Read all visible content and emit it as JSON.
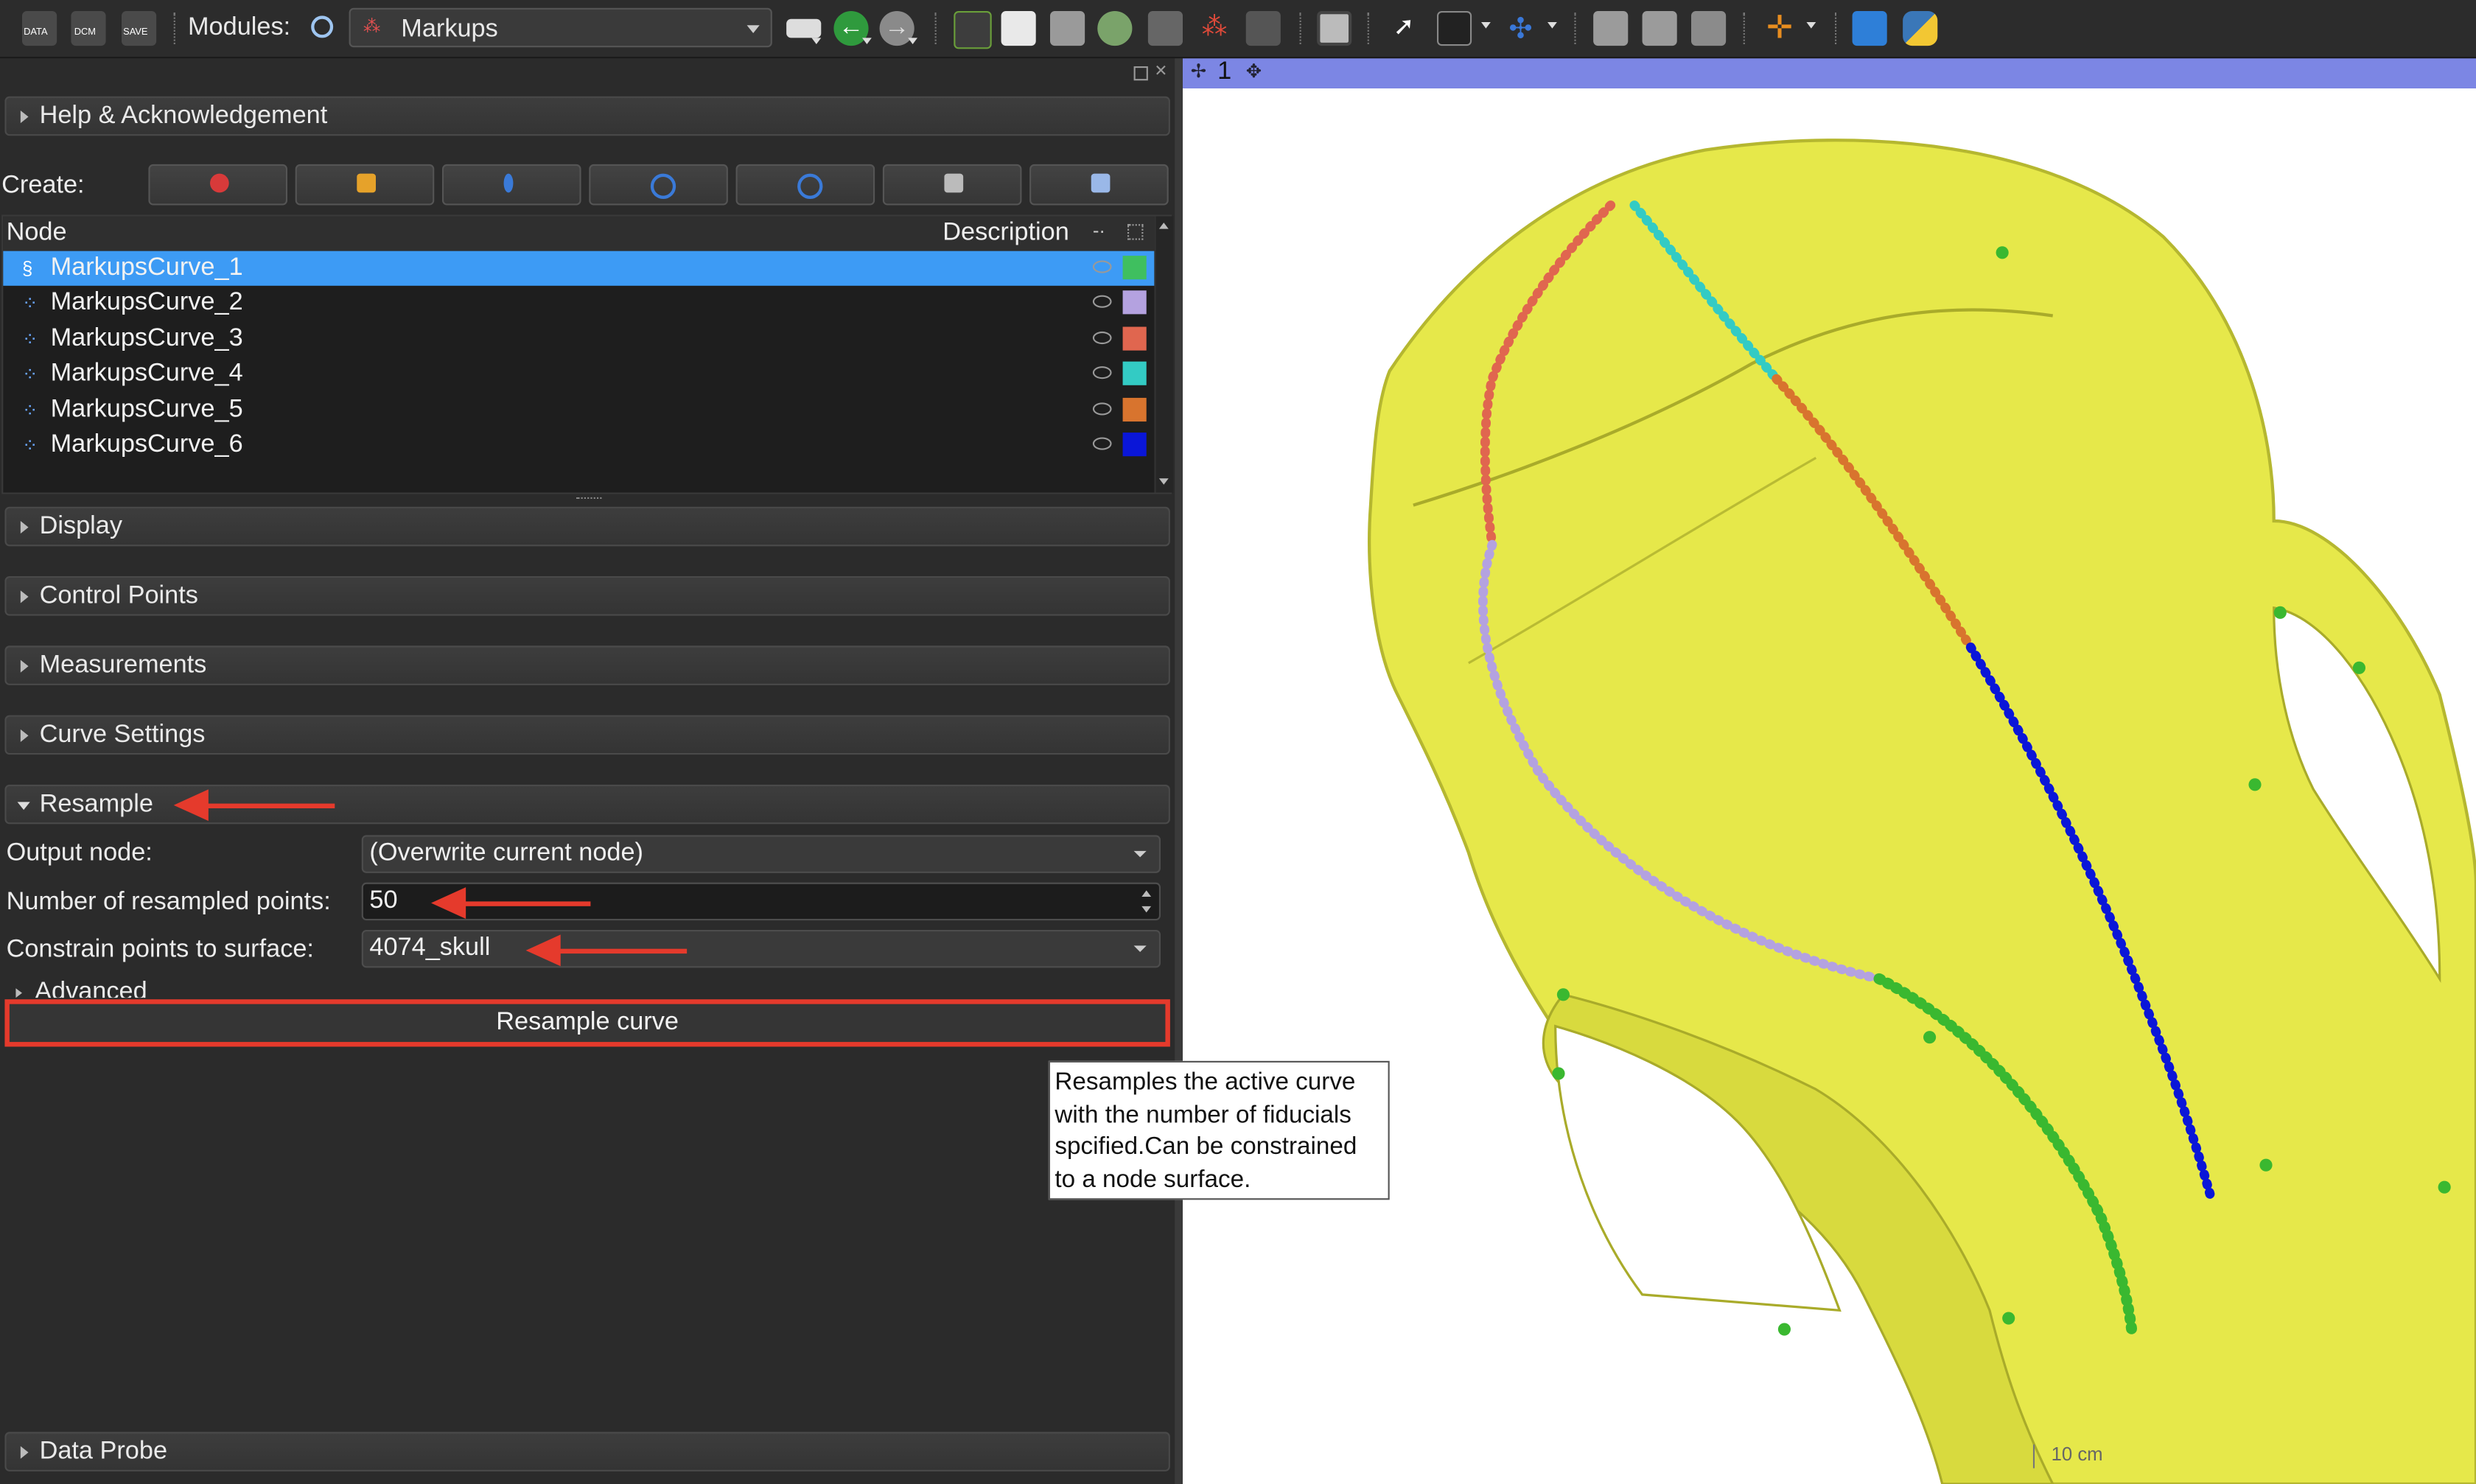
{
  "toolbar": {
    "data_label": "DATA",
    "dcm_label": "DCM",
    "save_label": "SAVE",
    "modules_label": "Modules:",
    "module_selected": "Markups"
  },
  "sections": {
    "help": "Help & Acknowledgement",
    "display": "Display",
    "control_points": "Control Points",
    "measurements": "Measurements",
    "curve_settings": "Curve Settings",
    "resample": "Resample",
    "advanced": "Advanced",
    "data_probe": "Data Probe"
  },
  "create": {
    "label": "Create:",
    "buttons": [
      "point-list",
      "line",
      "angle",
      "open-curve",
      "closed-curve",
      "plane",
      "roi"
    ]
  },
  "node_table": {
    "header_node": "Node",
    "header_description": "Description",
    "rows": [
      {
        "name": "MarkupsCurve_1",
        "color": "#3fbf5f",
        "selected": true
      },
      {
        "name": "MarkupsCurve_2",
        "color": "#b4a2e0",
        "selected": false
      },
      {
        "name": "MarkupsCurve_3",
        "color": "#e0664f",
        "selected": false
      },
      {
        "name": "MarkupsCurve_4",
        "color": "#33cbc4",
        "selected": false
      },
      {
        "name": "MarkupsCurve_5",
        "color": "#d8742e",
        "selected": false
      },
      {
        "name": "MarkupsCurve_6",
        "color": "#0a16d8",
        "selected": false
      }
    ]
  },
  "resample": {
    "output_node_label": "Output node:",
    "output_node_value": "(Overwrite current node)",
    "num_points_label": "Number of resampled points:",
    "num_points_value": "50",
    "constrain_label": "Constrain points to surface:",
    "constrain_value": "4074_skull",
    "button_label": "Resample curve",
    "tooltip": "Resamples the active curve with the number of fiducials spcified.Can be constrained to a node surface."
  },
  "view": {
    "number": "1",
    "scale_label": "10 cm"
  },
  "colors": {
    "selection": "#3d9bf5",
    "annotation_red": "#e53a2c",
    "skull": "#e6e84a",
    "view_bar": "#7c86e4"
  }
}
